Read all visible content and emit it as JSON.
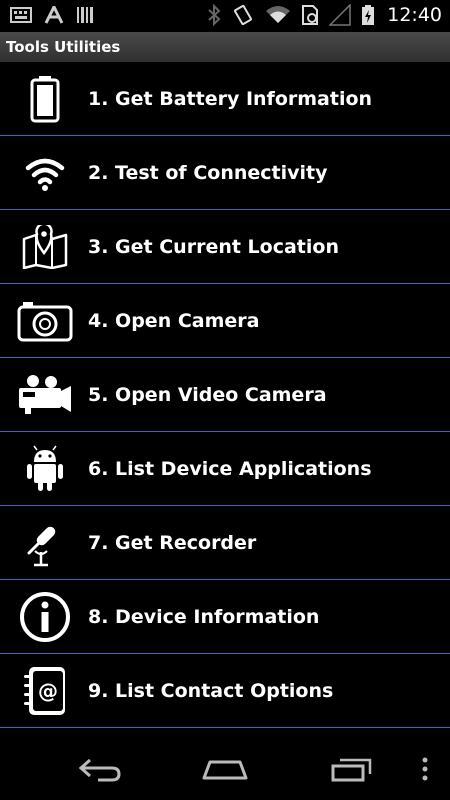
{
  "status_bar": {
    "time": "12:40",
    "left_icons": [
      "keyboard-icon",
      "notification-a-icon",
      "barcode-icon"
    ],
    "right_icons": [
      "bluetooth-icon",
      "vibrate-icon",
      "wifi-icon",
      "sim-icon",
      "cell-signal-icon",
      "battery-charging-icon"
    ]
  },
  "app": {
    "title": "Tools Utilities"
  },
  "menu": {
    "items": [
      {
        "label": "1. Get Battery Information",
        "icon": "battery-icon"
      },
      {
        "label": "2. Test of Connectivity",
        "icon": "wifi-icon"
      },
      {
        "label": "3. Get Current Location",
        "icon": "map-pin-icon"
      },
      {
        "label": "4. Open Camera",
        "icon": "camera-icon"
      },
      {
        "label": "5. Open Video Camera",
        "icon": "video-camera-icon"
      },
      {
        "label": "6. List Device Applications",
        "icon": "android-icon"
      },
      {
        "label": "7. Get Recorder",
        "icon": "microphone-icon"
      },
      {
        "label": "8. Device Information",
        "icon": "info-icon"
      },
      {
        "label": "9. List Contact Options",
        "icon": "contact-book-icon"
      }
    ]
  },
  "nav_bar": {
    "buttons": [
      "back-icon",
      "home-icon",
      "recent-apps-icon",
      "overflow-menu-icon"
    ]
  }
}
